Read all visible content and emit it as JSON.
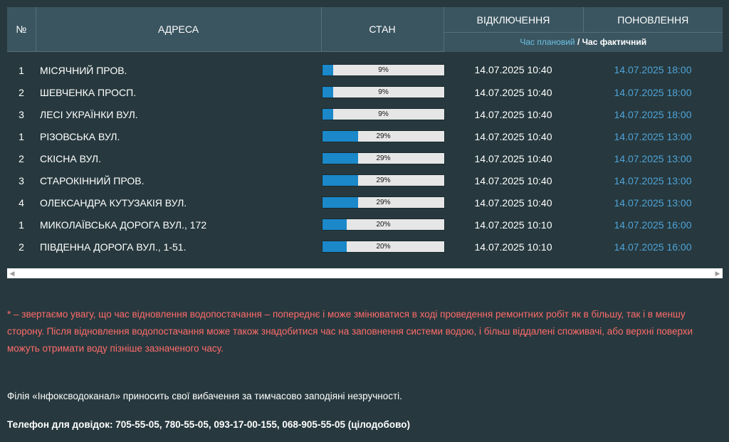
{
  "table": {
    "headers": {
      "num": "№",
      "address": "АДРЕСА",
      "state": "СТАН",
      "off": "ВІДКЛЮЧЕННЯ",
      "update": "ПОНОВЛЕННЯ",
      "time_planned": "Час плановий",
      "time_sep": " / ",
      "time_actual": "Час фактичний"
    },
    "rows": [
      {
        "num": "1",
        "address": "МІСЯЧНИЙ ПРОВ.",
        "progress": 9,
        "progress_label": "9%",
        "off": "14.07.2025 10:40",
        "update": "14.07.2025 18:00"
      },
      {
        "num": "2",
        "address": "ШЕВЧЕНКА ПРОСП.",
        "progress": 9,
        "progress_label": "9%",
        "off": "14.07.2025 10:40",
        "update": "14.07.2025 18:00"
      },
      {
        "num": "3",
        "address": "ЛЕСІ УКРАЇНКИ ВУЛ.",
        "progress": 9,
        "progress_label": "9%",
        "off": "14.07.2025 10:40",
        "update": "14.07.2025 18:00"
      },
      {
        "num": "1",
        "address": "РІЗОВСЬКА ВУЛ.",
        "progress": 29,
        "progress_label": "29%",
        "off": "14.07.2025 10:40",
        "update": "14.07.2025 13:00"
      },
      {
        "num": "2",
        "address": "СКІСНА ВУЛ.",
        "progress": 29,
        "progress_label": "29%",
        "off": "14.07.2025 10:40",
        "update": "14.07.2025 13:00"
      },
      {
        "num": "3",
        "address": "СТАРОКІННИЙ ПРОВ.",
        "progress": 29,
        "progress_label": "29%",
        "off": "14.07.2025 10:40",
        "update": "14.07.2025 13:00"
      },
      {
        "num": "4",
        "address": "ОЛЕКСАНДРА КУТУЗАКІЯ ВУЛ.",
        "progress": 29,
        "progress_label": "29%",
        "off": "14.07.2025 10:40",
        "update": "14.07.2025 13:00"
      },
      {
        "num": "1",
        "address": "МИКОЛАЇВСЬКА ДОРОГА ВУЛ., 172",
        "progress": 20,
        "progress_label": "20%",
        "off": "14.07.2025 10:10",
        "update": "14.07.2025 16:00"
      },
      {
        "num": "2",
        "address": "ПІВДЕННА ДОРОГА ВУЛ., 1-51.",
        "progress": 20,
        "progress_label": "20%",
        "off": "14.07.2025 10:10",
        "update": "14.07.2025 16:00"
      }
    ]
  },
  "scrollbar": {
    "left_arrow": "◀",
    "right_arrow": "▶"
  },
  "notice": "* – звертаємо увагу, що час відновлення водопостачання – попереднє і може змінюватися в ході проведення ремонтних робіт як в більшу, так і в меншу сторону. Після відновлення водопостачання може також знадобитися час на заповнення системи водою, і більш віддалені споживачі, або верхні поверхи можуть отримати воду пізніше зазначеного часу.",
  "apology": "Філія «Інфоксводоканал» приносить свої вибачення за тимчасово заподіяні незручності.",
  "phones": "Телефон для довідок: 705-55-05, 780-55-05, 093-17-00-155, 068-905-55-05 (цілодобово)",
  "colors": {
    "background": "#27393e",
    "header": "#3a5560",
    "progress_fill": "#1a88c9",
    "update_time": "#4fa3d9",
    "notice": "#ff6b6b"
  }
}
